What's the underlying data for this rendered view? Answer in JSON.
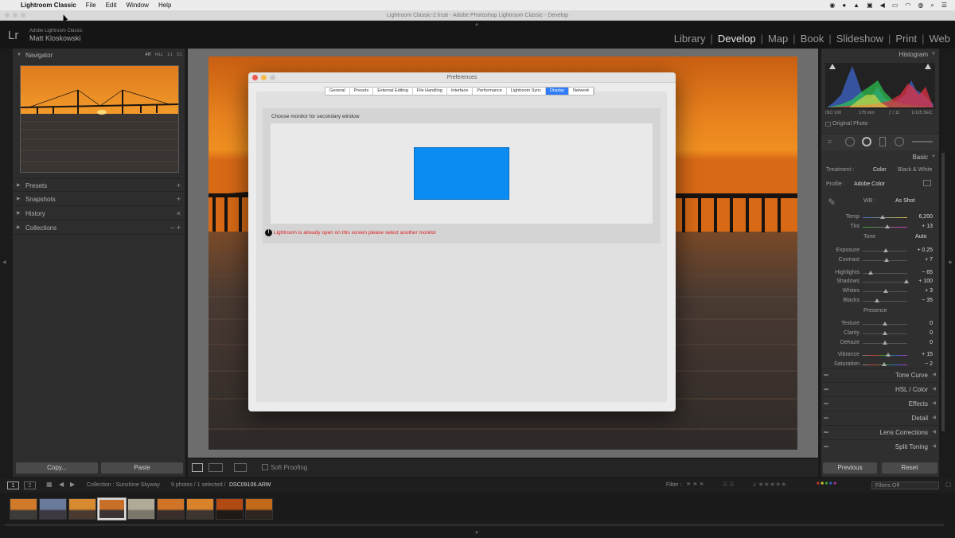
{
  "menubar": {
    "app_name": "Lightroom Classic",
    "items": [
      "File",
      "Edit",
      "Window",
      "Help"
    ]
  },
  "window_title": "Lightroom Classic-2.lrcat - Adobe Photoshop Lightroom Classic - Develop",
  "identity_plate": {
    "logo": "Lr",
    "product": "Adobe Lightroom Classic",
    "user": "Matt Kloskowski"
  },
  "modules": [
    "Library",
    "Develop",
    "Map",
    "Book",
    "Slideshow",
    "Print",
    "Web"
  ],
  "active_module": "Develop",
  "left_panel": {
    "navigator": {
      "title": "Navigator",
      "zoom_options": [
        "FIT",
        "FILL",
        "1:1",
        "3:1"
      ]
    },
    "sections": [
      {
        "label": "Presets",
        "action": "+"
      },
      {
        "label": "Snapshots",
        "action": "+"
      },
      {
        "label": "History",
        "action": "×"
      },
      {
        "label": "Collections",
        "action": "−  +"
      }
    ],
    "copy_button": "Copy...",
    "paste_button": "Paste"
  },
  "toolbar": {
    "soft_proofing": "Soft Proofing"
  },
  "right_panel": {
    "histogram": {
      "title": "Histogram",
      "iso": "ISO 100",
      "focal": "175 mm",
      "aperture": "ƒ / 11",
      "shutter": "1/125 SEC",
      "original_photo": "Original Photo"
    },
    "basic": {
      "title": "Basic",
      "treatment_label": "Treatment :",
      "treatment_color": "Color",
      "treatment_bw": "Black & White",
      "profile_label": "Profile :",
      "profile_value": "Adobe Color",
      "wb_label": "WB :",
      "wb_value": "As Shot",
      "tone_label": "Tone",
      "auto_label": "Auto",
      "presence_label": "Presence",
      "sliders": [
        {
          "label": "Temp",
          "value": "6,200",
          "pos": 0.45
        },
        {
          "label": "Tint",
          "value": "+ 13",
          "pos": 0.55
        },
        {
          "label": "Exposure",
          "value": "+ 0.25",
          "pos": 0.52
        },
        {
          "label": "Contrast",
          "value": "+ 7",
          "pos": 0.53
        },
        {
          "label": "Highlights",
          "value": "− 65",
          "pos": 0.17
        },
        {
          "label": "Shadows",
          "value": "+ 100",
          "pos": 0.98
        },
        {
          "label": "Whites",
          "value": "+ 3",
          "pos": 0.51
        },
        {
          "label": "Blacks",
          "value": "− 35",
          "pos": 0.32
        },
        {
          "label": "Texture",
          "value": "0",
          "pos": 0.5
        },
        {
          "label": "Clarity",
          "value": "0",
          "pos": 0.5
        },
        {
          "label": "Dehaze",
          "value": "0",
          "pos": 0.5
        },
        {
          "label": "Vibrance",
          "value": "+ 15",
          "pos": 0.57
        },
        {
          "label": "Saturation",
          "value": "− 2",
          "pos": 0.49
        }
      ]
    },
    "sections": [
      "Tone Curve",
      "HSL / Color",
      "Effects",
      "Detail",
      "Lens Corrections",
      "Split Toning"
    ],
    "previous_button": "Previous",
    "reset_button": "Reset"
  },
  "filmstrip_bar": {
    "page1": "1",
    "page2": "2",
    "collection": "Collection : Sunshine Skyway",
    "count": "9 photos / 1 selected /",
    "filename": "DSC09106.ARW",
    "filter_label": "Filter :",
    "filters_off": "Filters Off"
  },
  "preferences_dialog": {
    "title": "Preferences",
    "tabs": [
      "General",
      "Presets",
      "External Editing",
      "File Handling",
      "Interface",
      "Performance",
      "Lightroom Sync",
      "Display",
      "Network"
    ],
    "selected_tab": "Display",
    "group_label": "Choose monitor for secondary window",
    "warning": "Lightroom is already open on this screen please select another monitor",
    "monitor_color": "#0a8cf2"
  },
  "colors": {
    "accent": "#2f7cf6",
    "warning": "#dd2222"
  }
}
